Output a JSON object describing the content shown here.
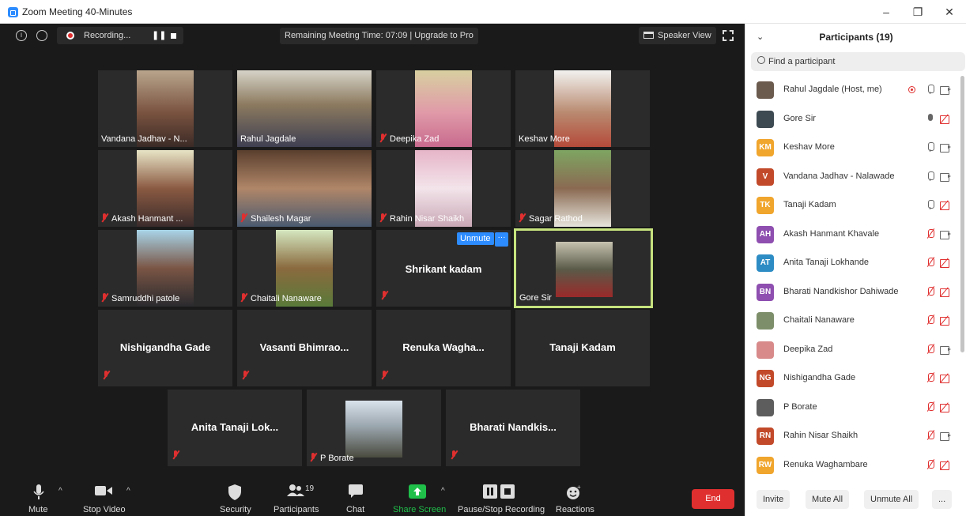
{
  "window": {
    "title": "Zoom Meeting 40-Minutes",
    "controls": [
      "–",
      "❐",
      "✕"
    ]
  },
  "topbar": {
    "info_glyph": "i",
    "recording_label": "Recording...",
    "pause_glyph": "❚❚",
    "remaining_time": "Remaining Meeting Time: 07:09 | Upgrade to Pro",
    "view_label": "Speaker View"
  },
  "tiles": [
    {
      "name": "Vandana Jadhav - N...",
      "muted": false
    },
    {
      "name": "Rahul Jagdale",
      "muted": false
    },
    {
      "name": "Deepika Zad",
      "muted": true
    },
    {
      "name": "Keshav More",
      "muted": false
    },
    {
      "name": "Akash Hanmant ...",
      "muted": true
    },
    {
      "name": "Shailesh Magar",
      "muted": true
    },
    {
      "name": "Rahin Nisar Shaikh",
      "muted": true
    },
    {
      "name": "Sagar Rathod",
      "muted": true
    },
    {
      "name": "Samruddhi patole",
      "muted": true
    },
    {
      "name": "Chaitali Nanaware",
      "muted": true
    },
    {
      "name": "Shrikant kadam",
      "muted": true,
      "unmute_label": "Unmute",
      "more_label": "···"
    },
    {
      "name": "Gore Sir",
      "muted": false,
      "active": true
    },
    {
      "name": "Nishigandha Gade",
      "muted": true
    },
    {
      "name": "Vasanti Bhimrao...",
      "muted": true
    },
    {
      "name": "Renuka Wagha...",
      "muted": true
    },
    {
      "name": "Tanaji Kadam",
      "muted": false
    },
    {
      "name": "Anita Tanaji Lok...",
      "muted": true
    },
    {
      "name": "P Borate",
      "muted": true
    },
    {
      "name": "Bharati Nandkis...",
      "muted": true
    }
  ],
  "toolbar": {
    "mute": "Mute",
    "stop_video": "Stop Video",
    "security": "Security",
    "participants": "Participants",
    "participants_count": "19",
    "chat": "Chat",
    "share_screen": "Share Screen",
    "pause_stop_recording": "Pause/Stop Recording",
    "reactions": "Reactions",
    "end": "End",
    "chevron": "^"
  },
  "panel": {
    "title": "Participants (19)",
    "chevron": "⌄",
    "search_placeholder": "Find a participant",
    "participants": [
      {
        "name": "Rahul Jagdale (Host, me)",
        "initials": "",
        "color": "#6b5a4e",
        "mic": "on",
        "cam": "on",
        "recording": true
      },
      {
        "name": "Gore Sir",
        "initials": "",
        "color": "#3d4a52",
        "mic": "dark",
        "cam": "off"
      },
      {
        "name": "Keshav More",
        "initials": "KM",
        "color": "#f0a52c",
        "mic": "on",
        "cam": "on"
      },
      {
        "name": "Vandana Jadhav - Nalawade",
        "initials": "V",
        "color": "#c24a2a",
        "mic": "on",
        "cam": "on"
      },
      {
        "name": "Tanaji Kadam",
        "initials": "TK",
        "color": "#f0a52c",
        "mic": "on",
        "cam": "off"
      },
      {
        "name": "Akash Hanmant Khavale",
        "initials": "AH",
        "color": "#8e4fb0",
        "mic": "off",
        "cam": "on"
      },
      {
        "name": "Anita Tanaji Lokhande",
        "initials": "AT",
        "color": "#2d8cc4",
        "mic": "off",
        "cam": "off"
      },
      {
        "name": "Bharati Nandkishor Dahiwade",
        "initials": "BN",
        "color": "#8e4fb0",
        "mic": "off",
        "cam": "off"
      },
      {
        "name": "Chaitali Nanaware",
        "initials": "",
        "color": "#7d8f6a",
        "mic": "off",
        "cam": "off"
      },
      {
        "name": "Deepika Zad",
        "initials": "",
        "color": "#d88a8a",
        "mic": "off",
        "cam": "on"
      },
      {
        "name": "Nishigandha Gade",
        "initials": "NG",
        "color": "#c24a2a",
        "mic": "off",
        "cam": "off"
      },
      {
        "name": "P Borate",
        "initials": "",
        "color": "#5d5d5d",
        "mic": "off",
        "cam": "off"
      },
      {
        "name": "Rahin Nisar Shaikh",
        "initials": "RN",
        "color": "#c24a2a",
        "mic": "off",
        "cam": "on"
      },
      {
        "name": "Renuka Waghambare",
        "initials": "RW",
        "color": "#f0a52c",
        "mic": "off",
        "cam": "off"
      }
    ],
    "buttons": {
      "invite": "Invite",
      "mute_all": "Mute All",
      "unmute_all": "Unmute All",
      "more": "..."
    }
  }
}
